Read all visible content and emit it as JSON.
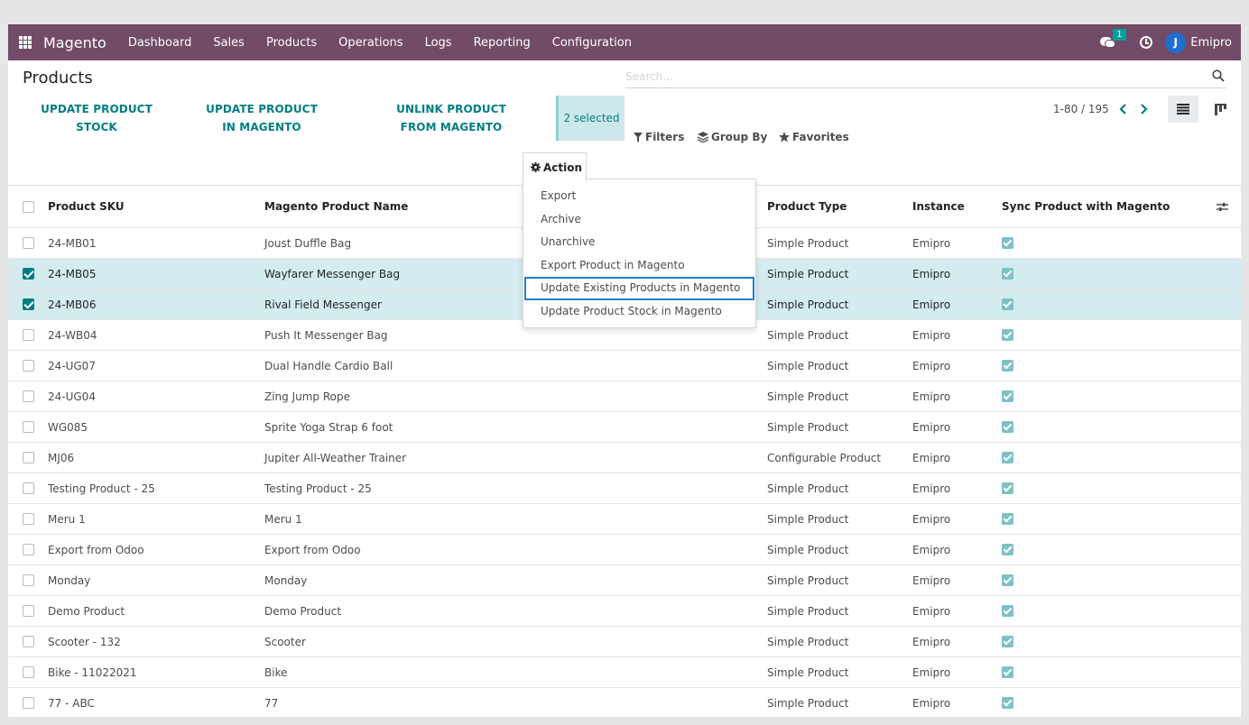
{
  "navbar": {
    "brand": "Magento",
    "menu": [
      "Dashboard",
      "Sales",
      "Products",
      "Operations",
      "Logs",
      "Reporting",
      "Configuration"
    ],
    "chat_count": "1",
    "user_initial": "J",
    "user_name": "Emipro",
    "color": "#714b67"
  },
  "page": {
    "title": "Products",
    "search_placeholder": "Search...",
    "buttons": {
      "update_stock": "UPDATE PRODUCT STOCK",
      "update_magento": "UPDATE PRODUCT IN MAGENTO",
      "unlink": "UNLINK PRODUCT FROM MAGENTO"
    },
    "selected": "2 selected",
    "filters": "Filters",
    "group_by": "Group By",
    "favorites": "Favorites",
    "pager": "1-80 / 195",
    "action_label": "Action"
  },
  "action_menu": [
    "Export",
    "Archive",
    "Unarchive",
    "Export Product in Magento",
    "Update Existing Products in Magento",
    "Update Product Stock in Magento"
  ],
  "table": {
    "headers": {
      "sku": "Product SKU",
      "name": "Magento Product Name",
      "type": "Product Type",
      "instance": "Instance",
      "sync": "Sync Product with Magento"
    },
    "rows": [
      {
        "sku": "24-MB01",
        "name": "Joust Duffle Bag",
        "type": "Simple Product",
        "instance": "Emipro",
        "selected": false
      },
      {
        "sku": "24-MB05",
        "name": "Wayfarer Messenger Bag",
        "type": "Simple Product",
        "instance": "Emipro",
        "selected": true
      },
      {
        "sku": "24-MB06",
        "name": "Rival Field Messenger",
        "type": "Simple Product",
        "instance": "Emipro",
        "selected": true
      },
      {
        "sku": "24-WB04",
        "name": "Push It Messenger Bag",
        "type": "Simple Product",
        "instance": "Emipro",
        "selected": false
      },
      {
        "sku": "24-UG07",
        "name": "Dual Handle Cardio Ball",
        "type": "Simple Product",
        "instance": "Emipro",
        "selected": false
      },
      {
        "sku": "24-UG04",
        "name": "Zing Jump Rope",
        "type": "Simple Product",
        "instance": "Emipro",
        "selected": false
      },
      {
        "sku": "WG085",
        "name": "Sprite Yoga Strap 6 foot",
        "type": "Simple Product",
        "instance": "Emipro",
        "selected": false
      },
      {
        "sku": "MJ06",
        "name": "Jupiter All-Weather Trainer",
        "type": "Configurable Product",
        "instance": "Emipro",
        "selected": false
      },
      {
        "sku": "Testing Product - 25",
        "name": "Testing Product - 25",
        "type": "Simple Product",
        "instance": "Emipro",
        "selected": false
      },
      {
        "sku": "Meru 1",
        "name": "Meru 1",
        "type": "Simple Product",
        "instance": "Emipro",
        "selected": false
      },
      {
        "sku": "Export from Odoo",
        "name": "Export from Odoo",
        "type": "Simple Product",
        "instance": "Emipro",
        "selected": false
      },
      {
        "sku": "Monday",
        "name": "Monday",
        "type": "Simple Product",
        "instance": "Emipro",
        "selected": false
      },
      {
        "sku": "Demo Product",
        "name": "Demo Product",
        "type": "Simple Product",
        "instance": "Emipro",
        "selected": false
      },
      {
        "sku": "Scooter - 132",
        "name": "Scooter",
        "type": "Simple Product",
        "instance": "Emipro",
        "selected": false
      },
      {
        "sku": "Bike - 11022021",
        "name": "Bike",
        "type": "Simple Product",
        "instance": "Emipro",
        "selected": false
      },
      {
        "sku": "77 - ABC",
        "name": "77",
        "type": "Simple Product",
        "instance": "Emipro",
        "selected": false
      }
    ]
  }
}
